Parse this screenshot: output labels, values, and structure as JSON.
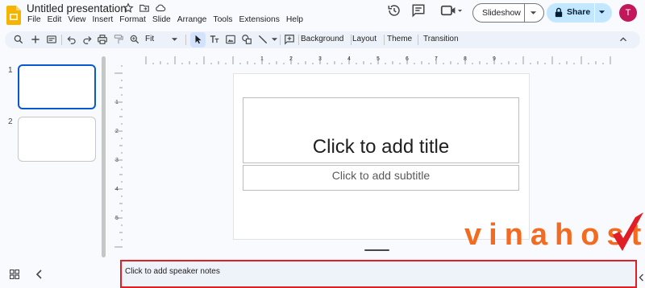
{
  "app": {
    "title": "Untitled presentation",
    "menu": [
      "File",
      "Edit",
      "View",
      "Insert",
      "Format",
      "Slide",
      "Arrange",
      "Tools",
      "Extensions",
      "Help"
    ],
    "logo_icon": "slides-logo-icon",
    "title_icons": [
      "star-icon",
      "move-to-folder-icon",
      "cloud-status-icon"
    ]
  },
  "header_right": {
    "icons": [
      "history-icon",
      "comments-icon",
      "video-call-icon"
    ],
    "slideshow_label": "Slideshow",
    "share_label": "Share",
    "avatar_initial": "T"
  },
  "toolbar": {
    "zoom_label": "Fit",
    "background_label": "Background",
    "layout_label": "Layout",
    "theme_label": "Theme",
    "transition_label": "Transition"
  },
  "filmstrip": {
    "slides": [
      {
        "number": "1",
        "selected": true
      },
      {
        "number": "2",
        "selected": false
      }
    ]
  },
  "rulers": {
    "horizontal_labels": [
      "1",
      "2",
      "3",
      "4",
      "5",
      "6",
      "7",
      "8",
      "9"
    ],
    "vertical_labels": [
      "1",
      "2",
      "3",
      "4",
      "5"
    ]
  },
  "slide": {
    "title_placeholder": "Click to add title",
    "subtitle_placeholder": "Click to add subtitle"
  },
  "notes": {
    "placeholder": "Click to add speaker notes"
  },
  "watermark": {
    "text": "vinahost."
  },
  "colors": {
    "accent_blue": "#0b57d0",
    "share_bg": "#c2e7ff",
    "toolbar_bg": "#edf2fa",
    "logo_yellow": "#f4b400",
    "avatar_bg": "#c2185b",
    "notes_outline": "#e01e25",
    "watermark_orange": "#f26b21"
  }
}
